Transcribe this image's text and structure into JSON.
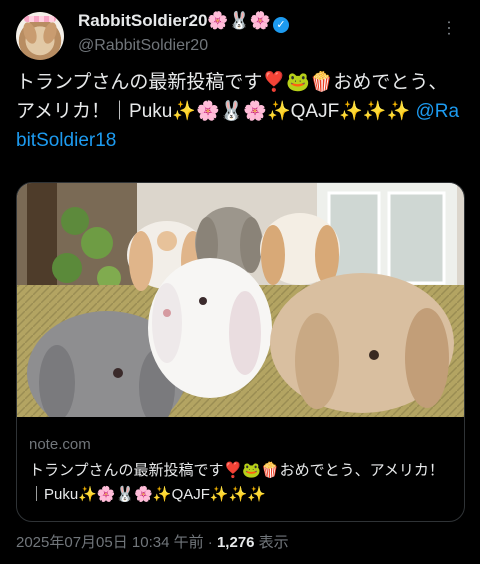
{
  "author": {
    "display_name": "RabbitSoldier20🌸🐰🌸",
    "handle": "@RabbitSoldier20",
    "verified_icon": "verified-badge-icon",
    "verified_glyph": "✓"
  },
  "more_icon": "…",
  "tweet": {
    "text": "トランプさんの最新投稿です❣️🐸🍿おめでとう、アメリカ！｜Puku✨🌸🐰🌸✨QAJF✨✨✨ ",
    "mention": "@RabitSoldier18"
  },
  "card": {
    "image_subject": "rabbits",
    "domain": "note.com",
    "title": "トランプさんの最新投稿です❣️🐸🍿おめでとう、アメリカ！｜Puku✨🌸🐰🌸✨QAJF✨✨✨"
  },
  "meta": {
    "timestamp": "2025年07月05日 10:34 午前",
    "separator": " · ",
    "views_count": "1,276",
    "views_label": " 表示"
  },
  "colors": {
    "background": "#000000",
    "text": "#e7e9ea",
    "secondary_text": "#71767b",
    "link": "#1d9bf0",
    "border": "#2f3336"
  }
}
